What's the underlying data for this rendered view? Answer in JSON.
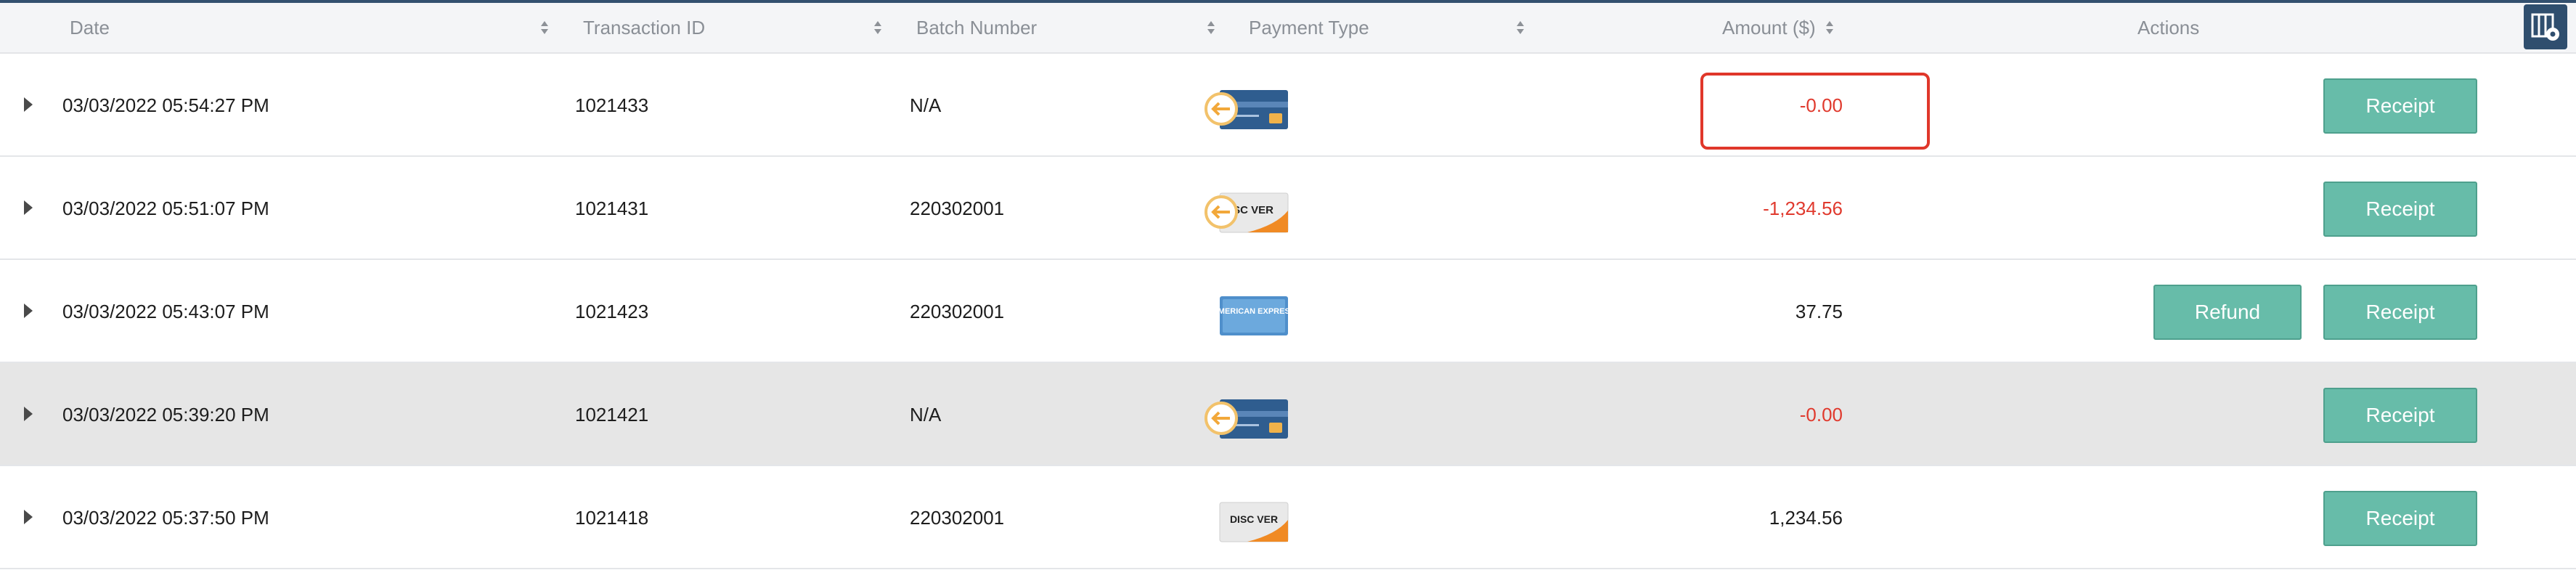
{
  "colors": {
    "accent": "#67bca9",
    "negative": "#e03a2e",
    "header_bar": "#33506f",
    "shaded_row": "#e6e6e6"
  },
  "table": {
    "headers": {
      "date": "Date",
      "transaction_id": "Transaction ID",
      "batch_number": "Batch Number",
      "payment_type": "Payment Type",
      "amount": "Amount ($)",
      "actions": "Actions"
    },
    "rows": [
      {
        "date": "03/03/2022 05:54:27 PM",
        "transaction_id": "1021433",
        "batch_number": "N/A",
        "payment_type": "card-refund-icon",
        "amount": "-0.00",
        "amount_negative": true,
        "refund_label": "",
        "receipt_label": "Receipt",
        "shaded": false
      },
      {
        "date": "03/03/2022 05:51:07 PM",
        "transaction_id": "1021431",
        "batch_number": "220302001",
        "payment_type": "discover-refund-icon",
        "card_text": "SC VER",
        "amount": "-1,234.56",
        "amount_negative": true,
        "refund_label": "",
        "receipt_label": "Receipt",
        "shaded": false
      },
      {
        "date": "03/03/2022 05:43:07 PM",
        "transaction_id": "1021423",
        "batch_number": "220302001",
        "payment_type": "amex-icon",
        "card_text": "AMERICAN EXPRESS",
        "amount": "37.75",
        "amount_negative": false,
        "refund_label": "Refund",
        "receipt_label": "Receipt",
        "shaded": false
      },
      {
        "date": "03/03/2022 05:39:20 PM",
        "transaction_id": "1021421",
        "batch_number": "N/A",
        "payment_type": "card-refund-icon",
        "amount": "-0.00",
        "amount_negative": true,
        "refund_label": "",
        "receipt_label": "Receipt",
        "shaded": true
      },
      {
        "date": "03/03/2022 05:37:50 PM",
        "transaction_id": "1021418",
        "batch_number": "220302001",
        "payment_type": "discover-icon",
        "card_text": "DISC VER",
        "amount": "1,234.56",
        "amount_negative": false,
        "refund_label": "",
        "receipt_label": "Receipt",
        "shaded": false
      }
    ]
  }
}
